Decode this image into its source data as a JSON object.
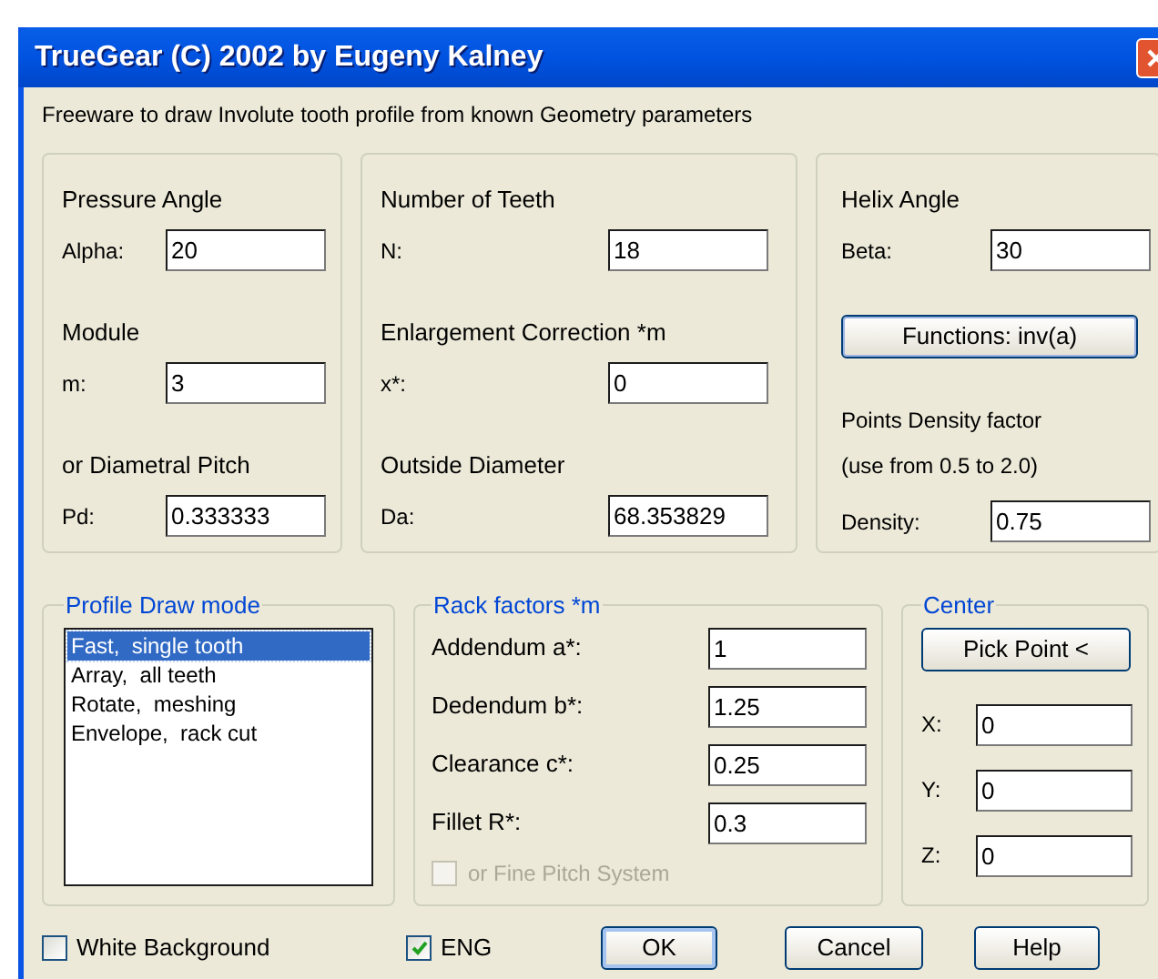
{
  "window": {
    "title": "TrueGear (C) 2002 by Eugeny Kalney"
  },
  "description": "Freeware to draw Involute tooth profile from known Geometry parameters",
  "parameter_columns": [
    {
      "items": [
        {
          "kind": "heading",
          "text": "Pressure Angle"
        },
        {
          "kind": "field",
          "label": "Alpha:",
          "value": "20"
        },
        {
          "kind": "heading",
          "text": "Module"
        },
        {
          "kind": "field",
          "label": "m:",
          "value": "3"
        },
        {
          "kind": "heading",
          "text": "or Diametral Pitch"
        },
        {
          "kind": "field",
          "label": "Pd:",
          "value": "0.333333"
        }
      ]
    },
    {
      "items": [
        {
          "kind": "heading",
          "text": "Number of Teeth"
        },
        {
          "kind": "field",
          "label": "N:",
          "value": "18"
        },
        {
          "kind": "heading",
          "text": "Enlargement Correction *m"
        },
        {
          "kind": "field",
          "label": "x*:",
          "value": "0"
        },
        {
          "kind": "heading",
          "text": "Outside Diameter"
        },
        {
          "kind": "field",
          "label": "Da:",
          "value": "68.353829"
        }
      ]
    },
    {
      "items": [
        {
          "kind": "heading",
          "text": "Helix Angle"
        },
        {
          "kind": "field",
          "label": "Beta:",
          "value": "30"
        },
        {
          "kind": "button",
          "text": "Functions: inv(a)"
        },
        {
          "kind": "note",
          "text": "Points Density factor"
        },
        {
          "kind": "note",
          "text": "(use from 0.5 to 2.0)"
        },
        {
          "kind": "field",
          "label": "Density:",
          "value": "0.75"
        }
      ]
    }
  ],
  "profile_draw_mode": {
    "title": "Profile Draw mode",
    "items": [
      {
        "label": "Fast,  single tooth",
        "selected": true
      },
      {
        "label": "Array,  all teeth",
        "selected": false
      },
      {
        "label": "Rotate,  meshing",
        "selected": false
      },
      {
        "label": "Envelope,  rack cut",
        "selected": false
      }
    ]
  },
  "rack_factors": {
    "title": "Rack factors *m",
    "fields": [
      {
        "label": "Addendum a*:",
        "value": "1"
      },
      {
        "label": "Dedendum b*:",
        "value": "1.25"
      },
      {
        "label": "Clearance c*:",
        "value": "0.25"
      },
      {
        "label": "Fillet R*:",
        "value": "0.3"
      }
    ],
    "fine_pitch": {
      "label": "or Fine Pitch System",
      "checked": false,
      "disabled": true
    }
  },
  "center": {
    "title": "Center",
    "button": "Pick Point <",
    "fields": [
      {
        "label": "X:",
        "value": "0"
      },
      {
        "label": "Y:",
        "value": "0"
      },
      {
        "label": "Z:",
        "value": "0"
      }
    ]
  },
  "options": [
    {
      "label": "White Background",
      "checked": false
    },
    {
      "label": "ENG",
      "checked": true
    }
  ],
  "buttons": [
    {
      "label": "OK",
      "default": true
    },
    {
      "label": "Cancel",
      "default": false
    },
    {
      "label": "Help",
      "default": false
    }
  ]
}
